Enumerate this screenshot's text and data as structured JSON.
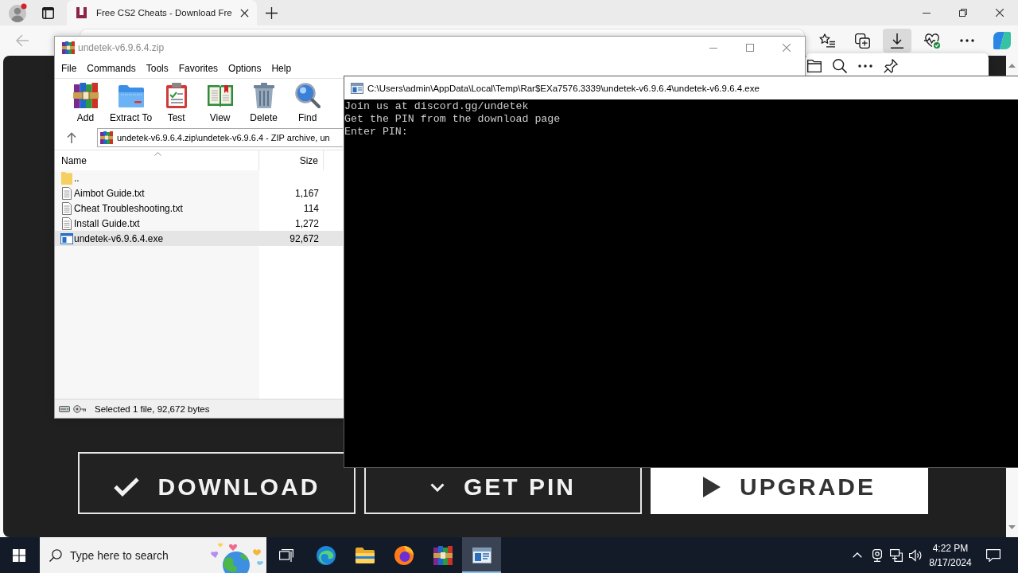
{
  "browser": {
    "tabs": [
      {
        "title": "Free CS2 Cheats - Download Fre",
        "selected": true
      }
    ],
    "back_button": {
      "disabled": true
    },
    "toolbar_buttons": [
      {
        "selected": false
      },
      {
        "selected": false
      },
      {
        "selected": true
      },
      {
        "selected": false
      },
      {
        "selected": false
      },
      {
        "selected": false
      }
    ],
    "page": {
      "buttons": [
        {
          "label": "DOWNLOAD",
          "kind": "outline"
        },
        {
          "label": "GET PIN",
          "kind": "outline"
        },
        {
          "label": "UPGRADE",
          "kind": "filled"
        }
      ]
    }
  },
  "winrar": {
    "title": "undetek-v6.9.6.4.zip",
    "menu": [
      "File",
      "Commands",
      "Tools",
      "Favorites",
      "Options",
      "Help"
    ],
    "toolbar": [
      "Add",
      "Extract To",
      "Test",
      "View",
      "Delete",
      "Find"
    ],
    "path": "undetek-v6.9.6.4.zip\\undetek-v6.9.6.4 - ZIP archive, un",
    "columns": [
      "Name",
      "Size"
    ],
    "files": [
      {
        "name": "..",
        "kind": "folder",
        "selected": false
      },
      {
        "name": "Aimbot Guide.txt",
        "size": "1,167",
        "kind": "text",
        "selected": false
      },
      {
        "name": "Cheat Troubleshooting.txt",
        "size": "114",
        "kind": "text",
        "selected": false
      },
      {
        "name": "Install Guide.txt",
        "size": "1,272",
        "kind": "text",
        "selected": false
      },
      {
        "name": "undetek-v6.9.6.4.exe",
        "size": "92,672",
        "kind": "program",
        "selected": true
      }
    ],
    "status": "Selected 1 file, 92,672 bytes"
  },
  "console": {
    "title": "C:\\Users\\admin\\AppData\\Local\\Temp\\Rar$EXa7576.3339\\undetek-v6.9.6.4\\undetek-v6.9.6.4.exe",
    "lines": [
      "Join us at discord.gg/undetek",
      "Get the PIN from the download page",
      "Enter PIN:"
    ]
  },
  "taskbar": {
    "search": {
      "placeholder": "Type here to search"
    },
    "apps": [
      {
        "selected": false
      },
      {
        "selected": false
      },
      {
        "selected": false
      },
      {
        "selected": false
      },
      {
        "selected": true
      }
    ],
    "clock": {
      "time": "4:22 PM",
      "date": "8/17/2024"
    }
  }
}
